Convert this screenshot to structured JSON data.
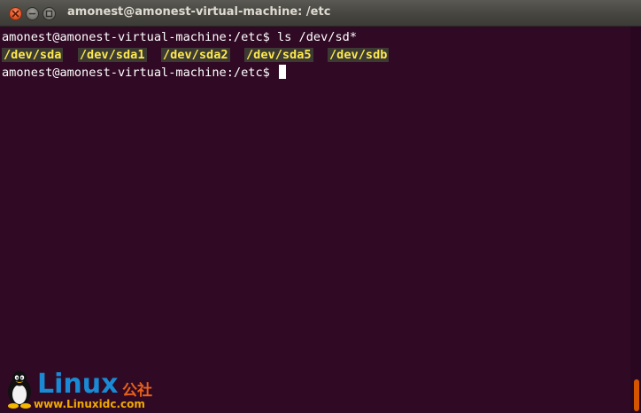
{
  "window": {
    "title": "amonest@amonest-virtual-machine: /etc",
    "close_icon": "close-icon",
    "minimize_icon": "minimize-icon",
    "maximize_icon": "maximize-icon"
  },
  "terminal": {
    "prompt": "amonest@amonest-virtual-machine:/etc$ ",
    "command": "ls /dev/sd*",
    "outputs": [
      "/dev/sda",
      "/dev/sda1",
      "/dev/sda2",
      "/dev/sda5",
      "/dev/sdb"
    ],
    "prompt2": "amonest@amonest-virtual-machine:/etc$ ",
    "colors": {
      "background": "#300a24",
      "text": "#ffffff",
      "device_text": "#fce94f",
      "device_highlight": "#3d3a33"
    }
  },
  "watermark": {
    "brand": "Linux",
    "brand_cn": "公社",
    "url": "www.Linuxidc.com",
    "icon": "tux-penguin-icon"
  }
}
